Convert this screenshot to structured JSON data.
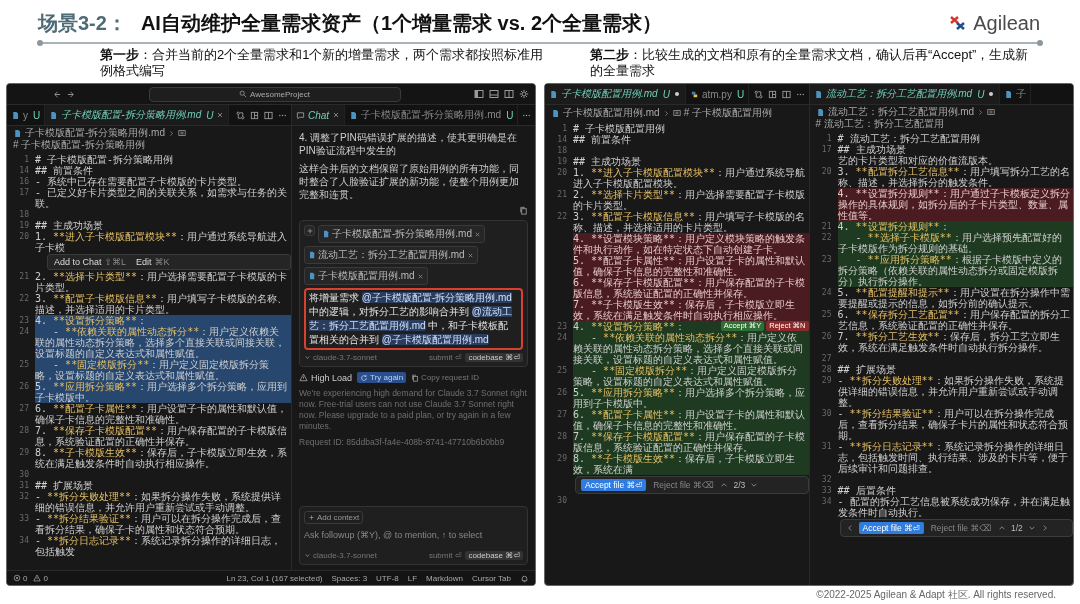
{
  "slide": {
    "title_prefix": "场景3-2：",
    "title": "AI自动维护全量需求资产（1个增量需求 vs. 2个全量需求）",
    "logo": "Agilean",
    "steps": [
      "**第一步**：合并当前的2个全量需求和1个新的增量需求，两个需求都按照标准用例格式编写",
      "**第二步**：比较生成的文档和原有的全量需求文档，确认后再“Accept”，生成新的全量需求"
    ],
    "footer": "©2022-2025 Agilean & Adapt 社区. All rights reserved."
  },
  "left_window": {
    "search": "AwesomeProject",
    "editor": {
      "tabs": [
        {
          "kind": "markdown",
          "label": "y",
          "status": "U",
          "modified": false,
          "selected": false
        },
        {
          "kind": "markdown",
          "label": "子卡模版配置-拆分策略用例.md",
          "status": "U",
          "modified": false,
          "selected": true
        }
      ],
      "breadcrumb": [
        "子卡模版配置-拆分策略用例.md",
        "# 子卡模版配置-拆分策略用例"
      ],
      "lines": [
        {
          "kind": "line",
          "num": "1",
          "text": "# 子卡模版配置-拆分策略用例",
          "selected": false
        },
        {
          "kind": "line",
          "num": "14",
          "text": "## 前置条件",
          "selected": false
        },
        {
          "kind": "line",
          "num": "16",
          "text": "- 系统中已存在需要配置子卡模版的卡片类型。",
          "selected": false
        },
        {
          "kind": "line",
          "num": "17",
          "text": "- 已定义好卡片类型之间的关联关系，如需求与任务的关联。",
          "selected": false
        },
        {
          "kind": "line",
          "num": "18",
          "selected": false
        },
        {
          "kind": "line",
          "num": "19",
          "text": "## 主成功场景",
          "selected": false
        },
        {
          "kind": "line",
          "num": "20",
          "lead": "1. ",
          "key": "**进入子卡模版配置模块**",
          "rest": "：用户通过系统导航进入子卡模",
          "selected": false
        },
        {
          "kind": "popup",
          "items": [
            {
              "label": "Add to Chat",
              "shortcut": "⇧⌘L"
            },
            {
              "label": "Edit",
              "shortcut": "⌘K"
            }
          ]
        },
        {
          "kind": "line",
          "num": "21",
          "lead": "2. ",
          "key": "**选择卡片类型**",
          "rest": "：用户选择需要配置子卡模版的卡片类型。",
          "selected": false
        },
        {
          "kind": "line",
          "num": "22",
          "lead": "3. ",
          "key": "**配置子卡模版信息**",
          "rest": "：用户填写子卡模版的名称、描述，并选择适用的卡片类型。",
          "selected": false
        },
        {
          "kind": "line",
          "num": "23",
          "lead": "4. ",
          "key": "**设置拆分策略**",
          "rest": "：",
          "selected": true
        },
        {
          "kind": "line",
          "num": "24",
          "lead": "   - ",
          "key": "**依赖关联的属性动态拆分**",
          "rest": "：用户定义依赖关联的属性动态拆分策略，选择多个直接关联或间接关联，设置标题的自定义表达式和属性赋值。",
          "selected": true
        },
        {
          "kind": "line",
          "num": "25",
          "lead": "   - ",
          "key": "**固定模版拆分**",
          "rest": "：用户定义固定模版拆分策略，设置标题的自定义表达式和属性赋值。",
          "selected": true
        },
        {
          "kind": "line",
          "num": "26",
          "lead": "5. ",
          "key": "**应用拆分策略**",
          "rest": "：用户选择多个拆分策略，应用到子卡模版中。",
          "selected": true
        },
        {
          "kind": "line",
          "num": "27",
          "lead": "6. ",
          "key": "**配置子卡属性**",
          "rest": "：用户设置子卡的属性和默认值，确保子卡信息的完整性和准确性。",
          "selected": false
        },
        {
          "kind": "line",
          "num": "28",
          "lead": "7. ",
          "key": "**保存子卡模版配置**",
          "rest": "：用户保存配置的子卡模版信息，系统验证配置的正确性并保存。",
          "selected": false
        },
        {
          "kind": "line",
          "num": "29",
          "lead": "8. ",
          "key": "**子卡模版生效**",
          "rest": "：保存后，子卡模版立即生效，系统在满足触发条件时自动执行相应操作。",
          "selected": false
        },
        {
          "kind": "line",
          "num": "30",
          "selected": false
        },
        {
          "kind": "line",
          "num": "31",
          "text": "## 扩展场景",
          "selected": false
        },
        {
          "kind": "line",
          "num": "32",
          "lead": "- ",
          "key": "**拆分失败处理**",
          "rest": "：如果拆分操作失败，系统提供详细的错误信息，并允许用户重新尝试或手动调整。",
          "selected": false
        },
        {
          "kind": "line",
          "num": "33",
          "lead": "- ",
          "key": "**拆分结果验证**",
          "rest": "：用户可以在拆分操作完成后，查看拆分结果，确保子卡的属性和状态符合预期。",
          "selected": false
        },
        {
          "kind": "line",
          "num": "34",
          "lead": "- ",
          "key": "**拆分日志记录**",
          "rest": "：系统记录拆分操作的详细日志，包括触发",
          "selected": false
        }
      ]
    },
    "chat": {
      "tabs": [
        {
          "kind": "chat",
          "label": "Chat",
          "modified": false,
          "selected": true
        },
        {
          "kind": "markdown",
          "label": "子卡模版配置-拆分策略用例.md",
          "status": "U",
          "modified": false,
          "selected": false
        }
      ],
      "messages": [
        "4. 调整了PIN码错误扩展的描述，使其更明确是在PIN验证流程中发生的",
        "这样合并后的文档保留了原始用例的所有功能，同时整合了人脸验证扩展的新功能，使整个用例更加完整和连贯。"
      ],
      "composer": {
        "chips": [
          "子卡模版配置-拆分策略用例.md",
          "流动工艺：拆分工艺配置用例.md",
          "子卡模版配置用例.md"
        ],
        "prompt": [
          {
            "text": "将增量需求 ",
            "mention": false
          },
          {
            "text": "@子卡模版配置-拆分策略用例.md",
            "mention": true
          },
          {
            "text": " 中的逻辑，对拆分工艺的影响合并到 ",
            "mention": false
          },
          {
            "text": "@流动工艺：拆分工艺配置用例.md",
            "mention": true
          },
          {
            "text": " 中，和子卡模板配置相关的合并到 ",
            "mention": false
          },
          {
            "text": "@子卡模版配置用例.md",
            "mention": true
          }
        ],
        "model": "claude-3.7-sonnet",
        "submit": "submit ⏎",
        "mode": "codebase ⌘⏎"
      },
      "error": {
        "title": "High Load",
        "retry": "Try again",
        "copy": "Copy request ID",
        "message": "We're experiencing high demand for Claude 3.7 Sonnet right now. Free-trial users can not use Claude 3.7 Sonnet right now. Please upgrade to a paid plan, or try again in a few minutes.",
        "request_id": "Request ID: 85ddba3f-fa4e-408b-8741-47710b6b0bb9"
      },
      "followup": {
        "add_context": "Add context",
        "placeholder": "Ask followup (⌘Y), @ to mention, ↑ to select",
        "model": "claude-3.7-sonnet",
        "submit": "submit ⏎",
        "mode": "codebase ⌘⏎"
      }
    },
    "status_bar": {
      "errors": "0",
      "warnings": "0",
      "items": [
        "Ln 23, Col 1 (167 selected)",
        "Spaces: 3",
        "UTF-8",
        "LF",
        "Markdown",
        "Cursor Tab"
      ]
    }
  },
  "right_window": {
    "panes": [
      {
        "tabs": [
          {
            "kind": "markdown",
            "label": "子卡模版配置用例.md",
            "status": "U",
            "modified": true,
            "selected": true
          },
          {
            "kind": "python",
            "label": "atm.py",
            "status": "U",
            "modified": false,
            "selected": false
          }
        ],
        "breadcrumb": [
          "子卡模版配置用例.md",
          "# 子卡模版配置用例"
        ],
        "lines": [
          {
            "kind": "line",
            "num": "1",
            "text": "# 子卡模版配置用例"
          },
          {
            "kind": "line",
            "num": "14",
            "text": "## 前置条件"
          },
          {
            "kind": "line",
            "num": "18"
          },
          {
            "kind": "line",
            "num": "19",
            "text": "## 主成功场景"
          },
          {
            "kind": "line",
            "num": "20",
            "lead": "1. ",
            "key": "**进入子卡模版配置模块**",
            "rest": "：用户通过系统导航进入子卡模版配置模块。"
          },
          {
            "kind": "line",
            "num": "21",
            "lead": "2. ",
            "key": "**选择卡片类型**",
            "rest": "：用户选择需要配置子卡模版的卡片类型。"
          },
          {
            "kind": "line",
            "num": "22",
            "lead": "3. ",
            "key": "**配置子卡模版信息**",
            "rest": "：用户填写子卡模版的名称、描述，并选择适用的卡片类型。"
          },
          {
            "kind": "removed",
            "text": "4. **设置模块策略**：用户定义模块策略的触发条件和执行动作，如在特定状态下自动创建子卡。"
          },
          {
            "kind": "removed",
            "text": "5. **配置子卡属性**：用户设置子卡的属性和默认值，确保子卡信息的完整性和准确性。"
          },
          {
            "kind": "removed",
            "text": "6. **保存子卡模版配置**：用户保存配置的子卡模版信息，系统验证配置的正确性并保存。"
          },
          {
            "kind": "removed",
            "text": "7. **子卡模版生效**：保存后，子卡模版立即生效，系统在满足触发条件时自动执行相应操作。"
          },
          {
            "kind": "added",
            "num": "23",
            "lead": "4. ",
            "key": "**设置拆分策略**",
            "rest": "：",
            "actions": [
              {
                "kind": "accept",
                "label": "Accept ⌘Y"
              },
              {
                "kind": "reject",
                "label": "Reject ⌘N"
              }
            ]
          },
          {
            "kind": "added",
            "num": "24",
            "lead": "   - ",
            "key": "**依赖关联的属性动态拆分**",
            "rest": "：用户定义依赖关联的属性动态拆分策略，选择多个直接关联或间接关联，设置标题的自定义表达式和属性赋值。"
          },
          {
            "kind": "added",
            "num": "25",
            "lead": "   - ",
            "key": "**固定模版拆分**",
            "rest": "：用户定义固定模版拆分策略，设置标题的自定义表达式和属性赋值。"
          },
          {
            "kind": "added",
            "num": "26",
            "lead": "5. ",
            "key": "**应用拆分策略**",
            "rest": "：用户选择多个拆分策略，应用到子卡模版中。"
          },
          {
            "kind": "added",
            "num": "27",
            "lead": "6. ",
            "key": "**配置子卡属性**",
            "rest": "：用户设置子卡的属性和默认值，确保子卡信息的完整性和准确性。"
          },
          {
            "kind": "added",
            "num": "28",
            "lead": "7. ",
            "key": "**保存子卡模版配置**",
            "rest": "：用户保存配置的子卡模版信息，系统验证配置的正确性并保存。"
          },
          {
            "kind": "added",
            "num": "29",
            "lead": "8. ",
            "key": "**子卡模版生效**",
            "rest": "：保存后，子卡模版立即生效，系统在满"
          },
          {
            "kind": "review_bar",
            "nav": false,
            "accept": "Accept file ⌘⏎",
            "reject": "Reject file ⌘⌫",
            "counter": "2/3"
          },
          {
            "kind": "line",
            "num": "30"
          }
        ]
      },
      {
        "tabs": [
          {
            "kind": "markdown",
            "label": "流动工艺：拆分工艺配置用例.md",
            "status": "U",
            "modified": true,
            "selected": true
          },
          {
            "kind": "markdown",
            "label": "子",
            "modified": false,
            "selected": false
          }
        ],
        "breadcrumb": [
          "流动工艺：拆分工艺配置用例.md",
          "# 流动工艺：拆分工艺配置用"
        ],
        "lines": [
          {
            "kind": "line",
            "num": "1",
            "text": "# 流动工艺：拆分工艺配置用例"
          },
          {
            "kind": "line",
            "num": "17",
            "text": "## 主成功场景"
          },
          {
            "kind": "line",
            "text": "艺的卡片类型和对应的价值流版本。"
          },
          {
            "kind": "line",
            "num": "20",
            "lead": "3. ",
            "key": "**配置拆分工艺信息**",
            "rest": "：用户填写拆分工艺的名称、描述，并选择拆分的触发条件。"
          },
          {
            "kind": "removed",
            "text": "4. **设置拆分规则**：用户通过子卡模板定义拆分操作的具体规则，如拆分后的子卡片类型、数量、属性值等。"
          },
          {
            "kind": "added",
            "num": "21",
            "lead": "4. ",
            "key": "**设置拆分规则**",
            "rest": "："
          },
          {
            "kind": "added",
            "num": "22",
            "lead": "   - ",
            "key": "**选择子卡模版**",
            "rest": "：用户选择预先配置好的子卡模版作为拆分规则的基础。"
          },
          {
            "kind": "added",
            "num": "23",
            "lead": "   - ",
            "key": "**应用拆分策略**",
            "rest": "：根据子卡模版中定义的拆分策略（依赖关联的属性动态拆分或固定模版拆分）执行拆分操作。"
          },
          {
            "kind": "line",
            "num": "24",
            "lead": "5. ",
            "key": "**配置提醒和提示**",
            "rest": "：用户设置在拆分操作中需要提醒或提示的信息，如拆分前的确认提示。"
          },
          {
            "kind": "line",
            "num": "25",
            "lead": "6. ",
            "key": "**保存拆分工艺配置**",
            "rest": "：用户保存配置的拆分工艺信息，系统验证配置的正确性并保存。"
          },
          {
            "kind": "line",
            "num": "26",
            "lead": "7. ",
            "key": "**拆分工艺生效**",
            "rest": "：保存后，拆分工艺立即生效，系统在满足触发条件时自动执行拆分操作。"
          },
          {
            "kind": "line",
            "num": "27"
          },
          {
            "kind": "line",
            "num": "28",
            "text": "## 扩展场景"
          },
          {
            "kind": "line",
            "num": "29",
            "lead": "- ",
            "key": "**拆分失败处理**",
            "rest": "：如果拆分操作失败，系统提供详细的错误信息，并允许用户重新尝试或手动调整。"
          },
          {
            "kind": "line",
            "num": "30",
            "lead": "- ",
            "key": "**拆分结果验证**",
            "rest": "：用户可以在拆分操作完成后，查看拆分结果，确保子卡片的属性和状态符合预期。"
          },
          {
            "kind": "line",
            "num": "31",
            "lead": "- ",
            "key": "**拆分日志记录**",
            "rest": "：系统记录拆分操作的详细日志，包括触发时间、执行结果、涉及的卡片等，便于后续审计和问题排查。"
          },
          {
            "kind": "line",
            "num": "32"
          },
          {
            "kind": "line",
            "num": "33",
            "text": "## 后置条件"
          },
          {
            "kind": "line",
            "num": "34",
            "text": "- 配置的拆分工艺信息被系统成功保存，并在满足触发条件时自动执行。"
          },
          {
            "kind": "review_bar",
            "nav": true,
            "accept": "Accept file ⌘⏎",
            "reject": "Reject file ⌘⌫",
            "counter": "1/2"
          }
        ]
      }
    ]
  }
}
